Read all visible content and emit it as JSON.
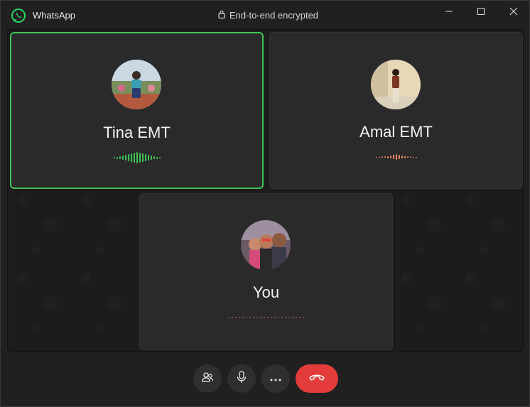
{
  "app": {
    "title": "WhatsApp",
    "brand_color": "#25d366"
  },
  "header": {
    "encryption_text": "End-to-end encrypted",
    "lock_icon": "lock-icon"
  },
  "window_controls": [
    "minimize-icon",
    "maximize-icon",
    "close-icon"
  ],
  "participants": [
    {
      "name": "Tina EMT",
      "speaking": true,
      "wave_color": "#3ec354"
    },
    {
      "name": "Amal EMT",
      "speaking": false,
      "wave_color": "#e8876a"
    },
    {
      "name": "You",
      "speaking": false,
      "wave_color": "#e06aa8"
    }
  ],
  "controls": [
    "participants-icon",
    "microphone-icon",
    "more-icon",
    "end-call-icon"
  ],
  "colors": {
    "end_call": "#e43b3b",
    "active_border": "#3ec354"
  }
}
